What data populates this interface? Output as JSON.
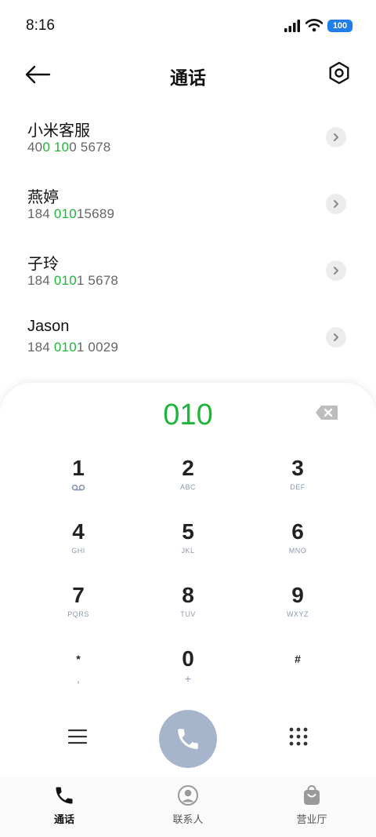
{
  "status_bar": {
    "time": "8:16",
    "battery": "100"
  },
  "header": {
    "title": "通话"
  },
  "contacts": [
    {
      "name": "小米客服",
      "number_parts": [
        "40",
        "0",
        " ",
        "10",
        "0 5678"
      ]
    },
    {
      "name": "燕婷",
      "number_parts": [
        "184 ",
        "010",
        "15689"
      ]
    },
    {
      "name": "子玲",
      "number_parts": [
        "184 ",
        "010",
        "1 5678"
      ]
    },
    {
      "name": "Jason",
      "number_parts": [
        "184 ",
        "010",
        "1 0029"
      ]
    }
  ],
  "dialer": {
    "dialed_number": "010",
    "keys": [
      {
        "digit": "1",
        "letters": ""
      },
      {
        "digit": "2",
        "letters": "ABC"
      },
      {
        "digit": "3",
        "letters": "DEF"
      },
      {
        "digit": "4",
        "letters": "GHI"
      },
      {
        "digit": "5",
        "letters": "JKL"
      },
      {
        "digit": "6",
        "letters": "MNO"
      },
      {
        "digit": "7",
        "letters": "PQRS"
      },
      {
        "digit": "8",
        "letters": "TUV"
      },
      {
        "digit": "9",
        "letters": "WXYZ"
      },
      {
        "digit": "*",
        "letters": ","
      },
      {
        "digit": "0",
        "letters": "+"
      },
      {
        "digit": "#",
        "letters": ""
      }
    ]
  },
  "bottom_nav": {
    "items": [
      {
        "label": "通话",
        "icon": "phone-icon",
        "active": true
      },
      {
        "label": "联系人",
        "icon": "person-icon",
        "active": false
      },
      {
        "label": "营业厅",
        "icon": "bag-icon",
        "active": false
      }
    ]
  },
  "colors": {
    "accent_green": "#20b53a",
    "call_button": "#a7b5cc",
    "letters_blue": "#8a99b5"
  }
}
